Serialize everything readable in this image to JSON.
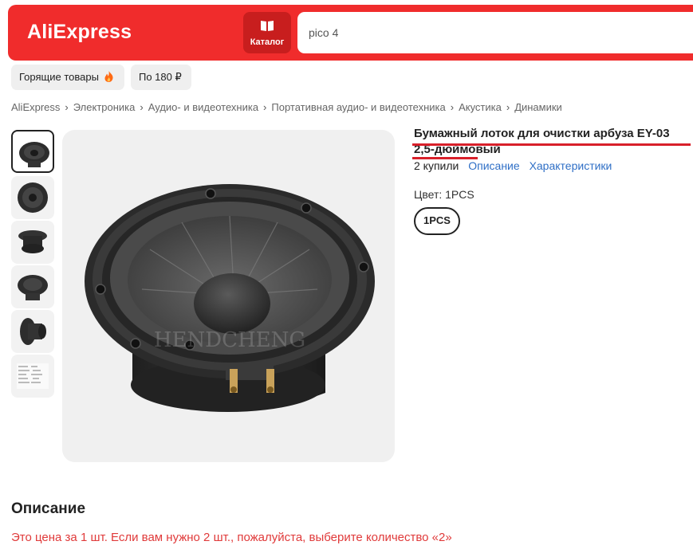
{
  "header": {
    "logo": "AliExpress",
    "catalog_label": "Каталог",
    "search_value": "pico 4",
    "brand_color": "#f02c2c"
  },
  "chips": {
    "hot_label": "Горящие товары",
    "hot_icon": "fire-icon",
    "price_label": "По 180 ₽"
  },
  "breadcrumb": [
    "AliExpress",
    "Электроника",
    "Аудио- и видеотехника",
    "Портативная аудио- и видеотехника",
    "Акустика",
    "Динамики"
  ],
  "product": {
    "title": "Бумажный лоток для очистки арбуза EY-03 2,5-дюймовый",
    "bought": "2 купили",
    "link_description": "Описание",
    "link_specs": "Характеристики",
    "color_label": "Цвет: 1PCS",
    "variant": "1PCS",
    "image_watermark": "HENDCHENG"
  },
  "description": {
    "title": "Описание",
    "text": "Это цена за 1 шт. Если вам нужно 2 шт., пожалуйста, выберите количество «2»"
  }
}
